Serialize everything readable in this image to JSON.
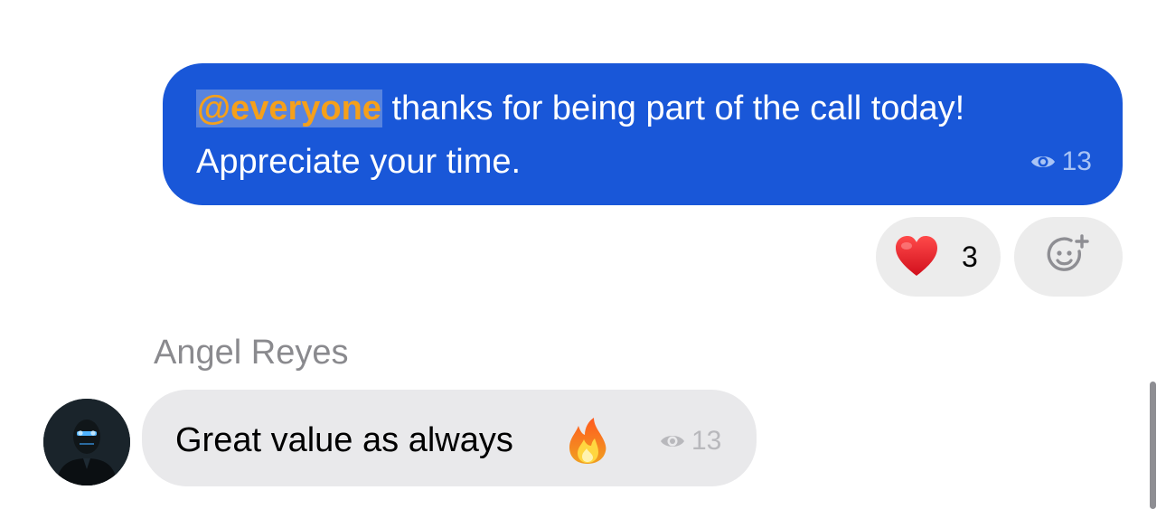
{
  "outgoing_message": {
    "mention": "@everyone",
    "text_line1": " thanks for being part of the call today!",
    "text_line2": "Appreciate your time.",
    "views": "13",
    "bubble_color": "#1957d8",
    "mention_color": "#f5a01a"
  },
  "reactions": [
    {
      "emoji": "heart",
      "count": "3"
    }
  ],
  "add_reaction": {
    "icon": "smiley-plus-icon"
  },
  "incoming_message": {
    "sender": "Angel Reyes",
    "text": "Great value as always",
    "emoji": "fire",
    "views": "13"
  },
  "colors": {
    "incoming_bubble": "#e9e9eb",
    "reaction_pill": "#ececec",
    "sender_name": "#8a8a8e"
  }
}
